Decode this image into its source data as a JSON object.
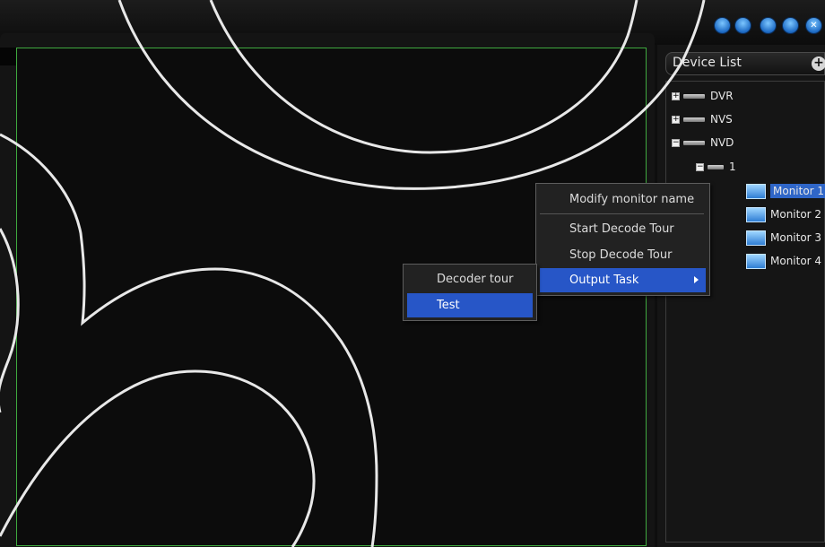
{
  "device_list": {
    "title": "Device List",
    "add_icon": "plus-circle-icon",
    "tree": [
      {
        "label": "DVR"
      },
      {
        "label": "NVS"
      },
      {
        "label": "NVD"
      },
      {
        "label": "1"
      },
      {
        "label": "Monitor 1"
      },
      {
        "label": "Monitor 2"
      },
      {
        "label": "Monitor 3"
      },
      {
        "label": "Monitor 4"
      }
    ]
  },
  "context_menu": {
    "items": [
      "Modify monitor name",
      "Start Decode Tour",
      "Stop Decode Tour",
      "Output Task"
    ]
  },
  "submenu": {
    "items": [
      "Decoder tour",
      "Test"
    ]
  },
  "window_buttons": [
    "lock-icon",
    "document-icon",
    "minimize-icon",
    "restore-icon",
    "close-icon"
  ],
  "colors": {
    "accent": "#2756c7",
    "frame_border": "#3fa93f"
  }
}
